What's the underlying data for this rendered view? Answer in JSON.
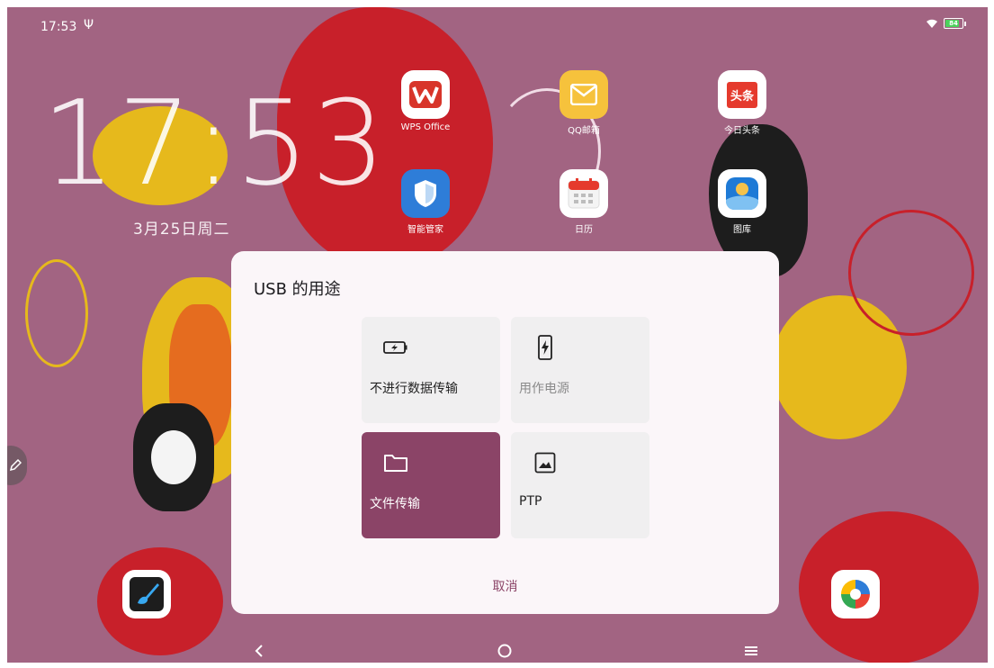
{
  "status_bar": {
    "time": "17:53",
    "usb_symbol": "Ψ",
    "battery_level": "84",
    "battery_fraction": 0.84,
    "battery_color": "#4cd15c"
  },
  "clock_widget": {
    "time": "17:53",
    "date": "3月25日周二"
  },
  "apps": [
    {
      "label": "WPS Office",
      "icon": "wps-icon"
    },
    {
      "label": "QQ邮箱",
      "icon": "mail-icon"
    },
    {
      "label": "今日头条",
      "icon": "toutiao-icon"
    },
    {
      "label": "智能管家",
      "icon": "shield-icon"
    },
    {
      "label": "日历",
      "icon": "calendar-icon"
    },
    {
      "label": "图库",
      "icon": "gallery-icon"
    }
  ],
  "toutiao_text": "头条",
  "dialog": {
    "title": "USB 的用途",
    "options": [
      {
        "label": "不进行数据传输",
        "icon": "battery-charging-icon",
        "state": "normal"
      },
      {
        "label": "用作电源",
        "icon": "phone-charging-icon",
        "state": "disabled"
      },
      {
        "label": "文件传输",
        "icon": "folder-icon",
        "state": "selected"
      },
      {
        "label": "PTP",
        "icon": "image-icon",
        "state": "normal"
      }
    ],
    "cancel_label": "取消"
  },
  "colors": {
    "accent": "#8b4467",
    "wallpaper": "#a26482"
  }
}
